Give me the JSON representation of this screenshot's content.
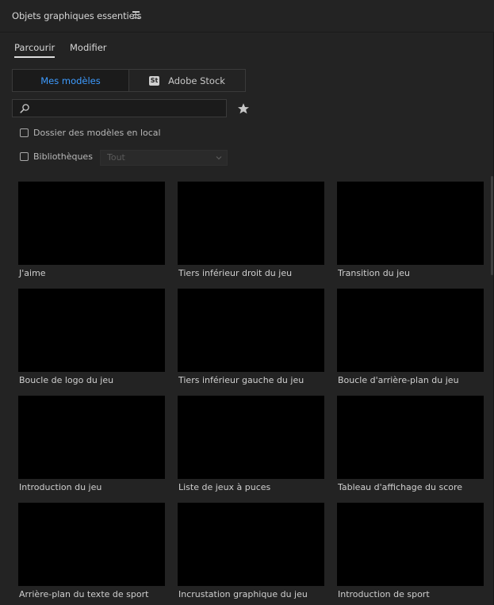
{
  "panel": {
    "title": "Objets graphiques essentiels",
    "menu_icon": "hamburger-icon"
  },
  "tabs": [
    {
      "label": "Parcourir",
      "active": true
    },
    {
      "label": "Modifier",
      "active": false
    }
  ],
  "source_toggle": {
    "mine_label": "Mes modèles",
    "stock_badge": "St",
    "stock_label": "Adobe Stock",
    "active": "mine"
  },
  "search": {
    "value": "",
    "placeholder": "",
    "icon": "search-icon",
    "favorite_icon": "star-icon"
  },
  "filters": {
    "local_folder_label": "Dossier des modèles en local",
    "local_folder_checked": false,
    "libraries_label": "Bibliothèques",
    "libraries_checked": false,
    "libraries_select_value": "Tout",
    "libraries_select_enabled": false
  },
  "templates": [
    {
      "label": "J'aime"
    },
    {
      "label": "Tiers inférieur droit du jeu"
    },
    {
      "label": "Transition du jeu"
    },
    {
      "label": "Boucle de logo du jeu"
    },
    {
      "label": "Tiers inférieur gauche du jeu"
    },
    {
      "label": "Boucle d'arrière-plan du jeu"
    },
    {
      "label": "Introduction du jeu"
    },
    {
      "label": "Liste de jeux à puces"
    },
    {
      "label": "Tableau d'affichage du score"
    },
    {
      "label": "Arrière-plan du texte de sport"
    },
    {
      "label": "Incrustation graphique du jeu"
    },
    {
      "label": "Introduction de sport"
    }
  ],
  "colors": {
    "accent": "#3d9bff",
    "panel_bg": "#232323",
    "thumb_bg": "#000000"
  }
}
